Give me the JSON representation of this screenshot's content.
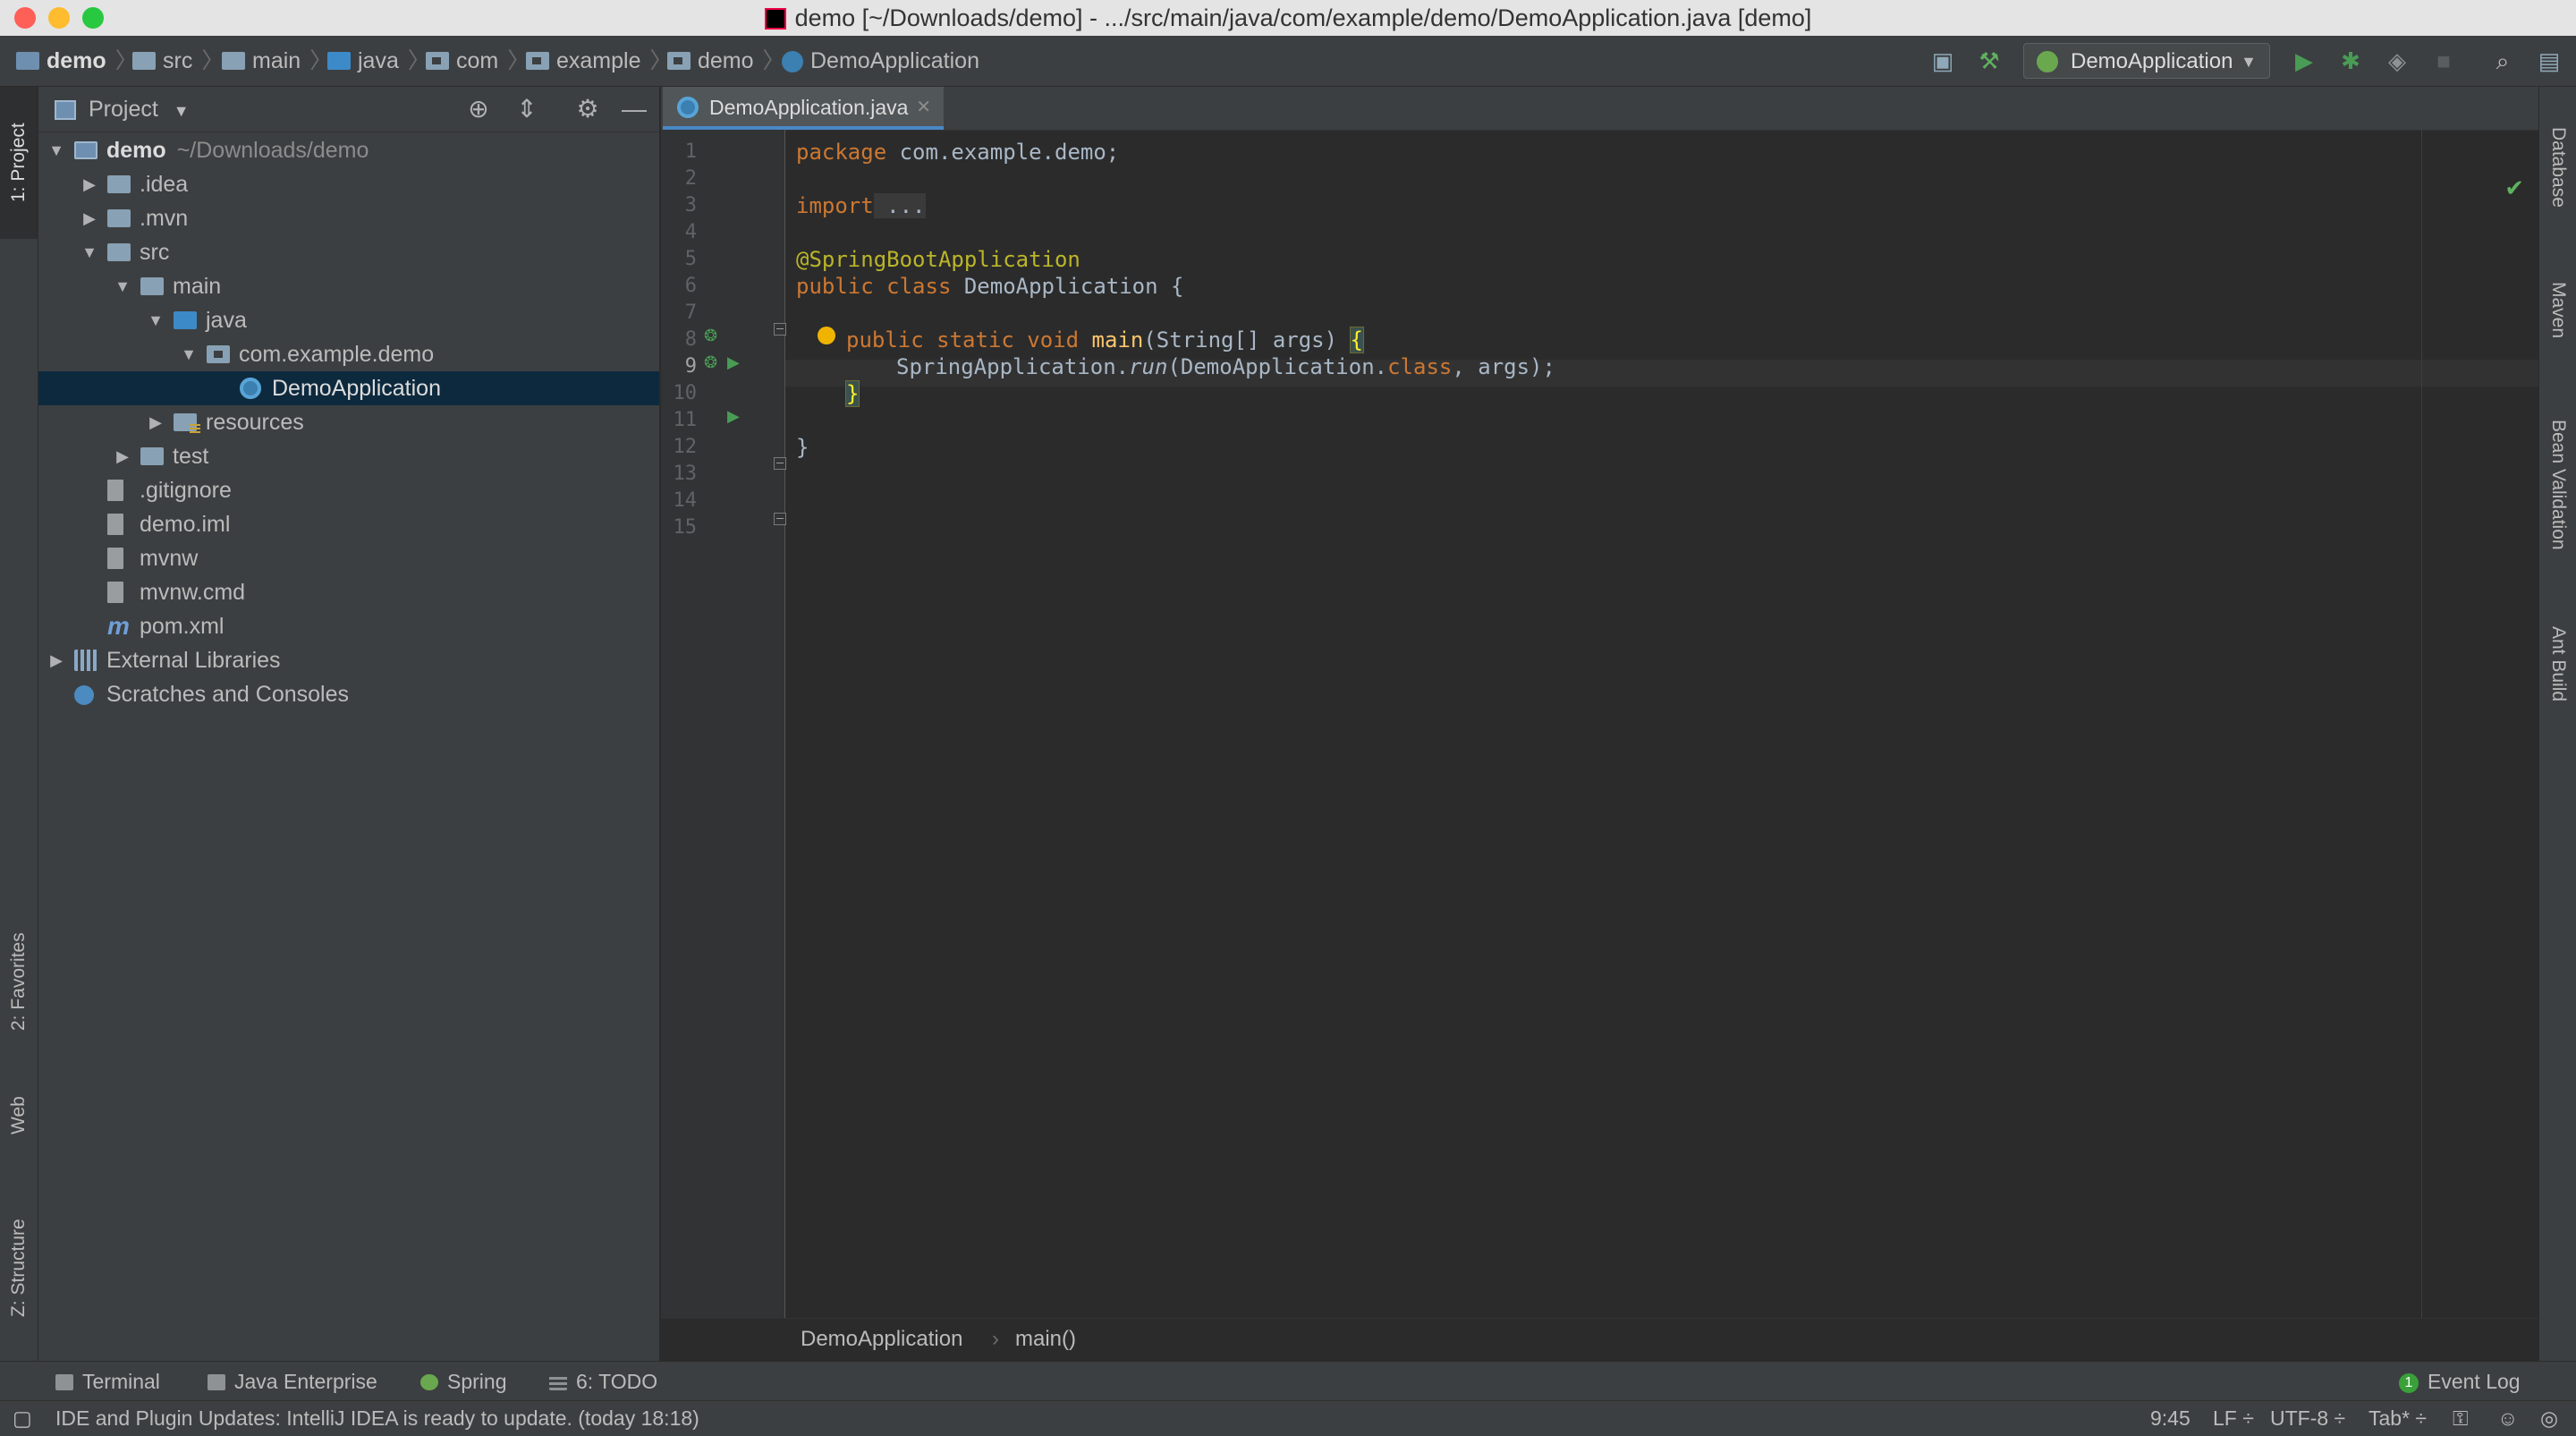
{
  "window": {
    "title": "demo [~/Downloads/demo] - .../src/main/java/com/example/demo/DemoApplication.java [demo]"
  },
  "navbar": {
    "crumbs": [
      "demo",
      "src",
      "main",
      "java",
      "com",
      "example",
      "demo",
      "DemoApplication"
    ],
    "run_config": "DemoApplication"
  },
  "left_tabs": {
    "project": "1: Project",
    "favorites": "2: Favorites",
    "web": "Web",
    "structure": "Z: Structure"
  },
  "right_tabs": {
    "database": "Database",
    "maven": "Maven",
    "bean_validation": "Bean Validation",
    "ant_build": "Ant Build"
  },
  "project_panel": {
    "title": "Project",
    "tree": [
      {
        "label": "demo",
        "suffix": "~/Downloads/demo",
        "depth": 0,
        "expanded": "open",
        "icon": "module-icon"
      },
      {
        "label": ".idea",
        "depth": 1,
        "expanded": "closed",
        "icon": "folder-icon"
      },
      {
        "label": ".mvn",
        "depth": 1,
        "expanded": "closed",
        "icon": "folder-icon"
      },
      {
        "label": "src",
        "depth": 1,
        "expanded": "open",
        "icon": "folder-icon"
      },
      {
        "label": "main",
        "depth": 2,
        "expanded": "open",
        "icon": "folder-icon"
      },
      {
        "label": "java",
        "depth": 3,
        "expanded": "open",
        "icon": "source-folder-icon"
      },
      {
        "label": "com.example.demo",
        "depth": 4,
        "expanded": "open",
        "icon": "package-icon"
      },
      {
        "label": "DemoApplication",
        "depth": 5,
        "expanded": "none",
        "icon": "spring-class-icon",
        "selected": true
      },
      {
        "label": "resources",
        "depth": 3,
        "expanded": "closed",
        "icon": "resources-folder-icon"
      },
      {
        "label": "test",
        "depth": 2,
        "expanded": "closed",
        "icon": "folder-icon"
      },
      {
        "label": ".gitignore",
        "depth": 1,
        "expanded": "none",
        "icon": "file-icon"
      },
      {
        "label": "demo.iml",
        "depth": 1,
        "expanded": "none",
        "icon": "file-icon"
      },
      {
        "label": "mvnw",
        "depth": 1,
        "expanded": "none",
        "icon": "file-icon"
      },
      {
        "label": "mvnw.cmd",
        "depth": 1,
        "expanded": "none",
        "icon": "file-icon"
      },
      {
        "label": "pom.xml",
        "depth": 1,
        "expanded": "none",
        "icon": "maven-icon"
      },
      {
        "label": "External Libraries",
        "depth": 0,
        "expanded": "closed",
        "icon": "libraries-icon"
      },
      {
        "label": "Scratches and Consoles",
        "depth": 0,
        "expanded": "none",
        "icon": "scratches-icon"
      }
    ]
  },
  "editor": {
    "tab_label": "DemoApplication.java",
    "line_numbers": [
      "1",
      "2",
      "3",
      "4",
      "5",
      "6",
      "7",
      "8",
      "9",
      "10",
      "11",
      "12",
      "13",
      "14",
      "15"
    ],
    "current_line": "9",
    "code": {
      "l1_kw": "package",
      "l1_rest": " com.example.demo;",
      "l3_kw": "import",
      "l3_rest": " ...",
      "l6_ann": "@SpringBootApplication",
      "l7_kw": "public class",
      "l7_rest": " DemoApplication {",
      "l9_kw": "public static void",
      "l9_fn": "main",
      "l9_rest": "(String[] args) ",
      "l9_brace": "{",
      "l10_pre": "SpringApplication.",
      "l10_it": "run",
      "l10_mid": "(DemoApplication.",
      "l10_kw": "class",
      "l10_post": ", args);",
      "l11_brace": "}",
      "l13_brace": "}"
    },
    "breadcrumb": [
      "DemoApplication",
      "main()"
    ]
  },
  "bottom_tools": {
    "terminal": "Terminal",
    "java_enterprise": "Java Enterprise",
    "spring": "Spring",
    "todo": "6: TODO",
    "event_log": "Event Log",
    "event_count": "1"
  },
  "status_bar": {
    "message": "IDE and Plugin Updates: IntelliJ IDEA is ready to update. (today 18:18)",
    "position": "9:45",
    "line_sep": "LF ÷",
    "encoding": "UTF-8 ÷",
    "indent": "Tab* ÷"
  },
  "colors": {
    "keyword": "#cc7832",
    "annotation": "#bbb529",
    "method": "#ffc66d",
    "text": "#a9b7c6",
    "selection": "#0d293e",
    "run_green": "#499c54"
  }
}
